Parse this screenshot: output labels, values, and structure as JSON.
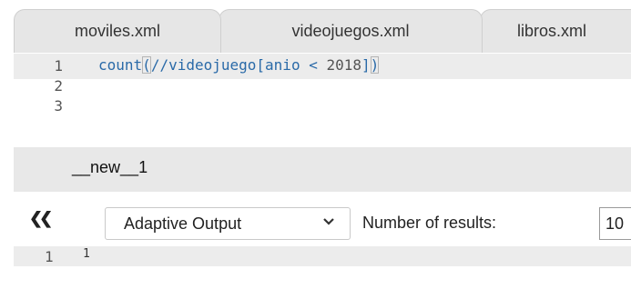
{
  "file_tabs": [
    {
      "label": "moviles.xml"
    },
    {
      "label": "videojuegos.xml"
    },
    {
      "label": "libros.xml"
    }
  ],
  "editor": {
    "line_numbers": [
      "1",
      "2",
      "3"
    ],
    "query": {
      "fn": "count",
      "open_paren": "(",
      "path_start": "//videojuego[anio < ",
      "number": "2018",
      "close_bracket": "]",
      "close_paren": ")"
    }
  },
  "result_tab": {
    "label": "__new__1"
  },
  "toolbar": {
    "prev_icon": "double-chevron-left-icon",
    "output_mode": "Adaptive Output",
    "results_label": "Number of results:",
    "results_value": "10"
  },
  "output": {
    "line_number": "1",
    "value": "1"
  },
  "colors": {
    "tab_bg": "#e6e6e6",
    "active_line_bg": "#ececec",
    "code_blue": "#2a6aa8"
  }
}
